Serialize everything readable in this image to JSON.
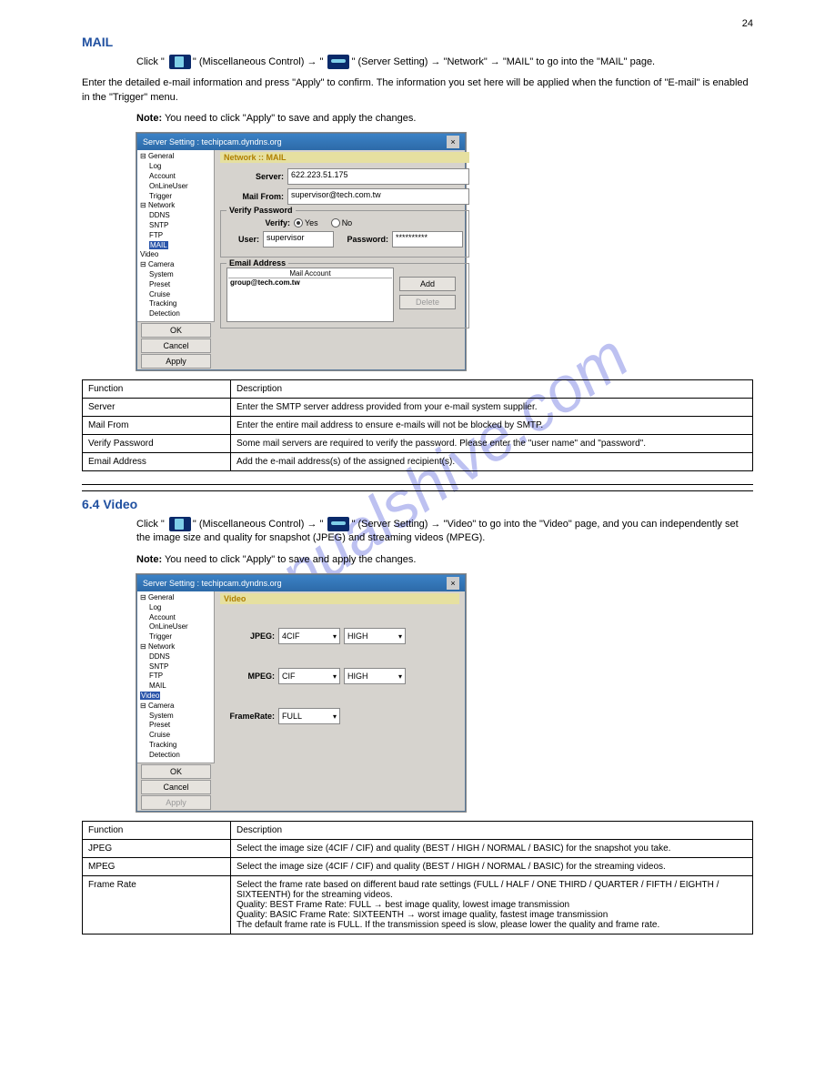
{
  "page_number": "24",
  "watermark": "manualshive.com",
  "section1": {
    "title": "MAIL",
    "intro_prefix": "Click \"",
    "intro_icon1_label": "(Miscellaneous Control)",
    "intro_arrow": " → \"",
    "intro_icon2_label": "(Server Setting)",
    "intro_suffix": " → \"Network\" → \"MAIL\" to go into the \"MAIL\" page.",
    "desc": "Enter the detailed e-mail information and press \"Apply\" to confirm. The information you set here will be applied when the function of \"E-mail\" is enabled in the \"Trigger\" menu.",
    "note_label": "Note:",
    "note_text": " You need to click \"Apply\" to save and apply the changes."
  },
  "dialog1": {
    "title": "Server Setting :    techipcam.dyndns.org",
    "tree_general": "General",
    "tree_log": "Log",
    "tree_account": "Account",
    "tree_onlineuser": "OnLineUser",
    "tree_trigger": "Trigger",
    "tree_network": "Network",
    "tree_ddns": "DDNS",
    "tree_sntp": "SNTP",
    "tree_ftp": "FTP",
    "tree_mail": "MAIL",
    "tree_video": "Video",
    "tree_camera": "Camera",
    "tree_system": "System",
    "tree_preset": "Preset",
    "tree_cruise": "Cruise",
    "tree_tracking": "Tracking",
    "tree_detection": "Detection",
    "pane_header": "Network :: MAIL",
    "server_label": "Server:",
    "server_value": "622.223.51.175",
    "mailfrom_label": "Mail From:",
    "mailfrom_value": "supervisor@tech.com.tw",
    "verify_group": "Verify Password",
    "verify_label": "Verify:",
    "verify_yes": "Yes",
    "verify_no": "No",
    "user_label": "User:",
    "user_value": "supervisor",
    "password_label": "Password:",
    "password_value": "**********",
    "email_group": "Email Address",
    "mail_account_hdr": "Mail Account",
    "mail_entry": "group@tech.com.tw",
    "add_btn": "Add",
    "delete_btn": "Delete",
    "ok_btn": "OK",
    "cancel_btn": "Cancel",
    "apply_btn": "Apply"
  },
  "table1": {
    "r0c0": "Function",
    "r0c1": "Description",
    "r1c0": "Server",
    "r1c1": "Enter the SMTP server address provided from your e-mail system supplier.",
    "r2c0": "Mail From",
    "r2c1": "Enter the entire mail address to ensure e-mails will not be blocked by SMTP.",
    "r3c0": "Verify Password",
    "r3c1": "Some mail servers are required to verify the password. Please enter the \"user name\" and \"password\".",
    "r4c0": "Email Address",
    "r4c1": "Add the e-mail address(s) of the assigned recipient(s)."
  },
  "section2": {
    "title": "6.4 Video",
    "intro_prefix": "Click \"",
    "intro_icon1_label": "(Miscellaneous Control)",
    "intro_arrow": " → \"",
    "intro_icon2_label": "(Server Setting)",
    "intro_suffix": " → \"Video\" to go into the \"Video\" page, and you can independently set the image size and quality for snapshot (JPEG) and streaming videos (MPEG).",
    "note_label": "Note:",
    "note_text": " You need to click \"Apply\" to save and apply the changes."
  },
  "dialog2": {
    "title": "Server Setting :    techipcam.dyndns.org",
    "pane_header": "Video",
    "jpeg_label": "JPEG:",
    "jpeg_size": "4CIF",
    "jpeg_quality": "HIGH",
    "mpeg_label": "MPEG:",
    "mpeg_size": "CIF",
    "mpeg_quality": "HIGH",
    "framerate_label": "FrameRate:",
    "framerate_value": "FULL"
  },
  "table2": {
    "r0c0": "Function",
    "r0c1": "Description",
    "r1c0": "JPEG",
    "r1c1": "Select the image size (4CIF / CIF) and quality (BEST / HIGH / NORMAL / BASIC) for the snapshot you take.",
    "r2c0": "MPEG",
    "r2c1": "Select the image size (4CIF / CIF) and quality (BEST / HIGH / NORMAL / BASIC) for the streaming videos.",
    "r3c0": "Frame Rate",
    "r3c1_line1": "Select the frame rate based on different baud rate settings (FULL / HALF / ONE THIRD / QUARTER / FIFTH / EIGHTH / SIXTEENTH) for the streaming videos.",
    "r3c1_line2": "Quality: BEST     Frame Rate: FULL   → best image quality, lowest image transmission",
    "r3c1_line3": "Quality: BASIC   Frame Rate: SIXTEENTH  →  worst image quality, fastest image transmission",
    "r3c1_line4": "The default frame rate is FULL. If the transmission speed is slow, please lower the quality and frame rate."
  }
}
